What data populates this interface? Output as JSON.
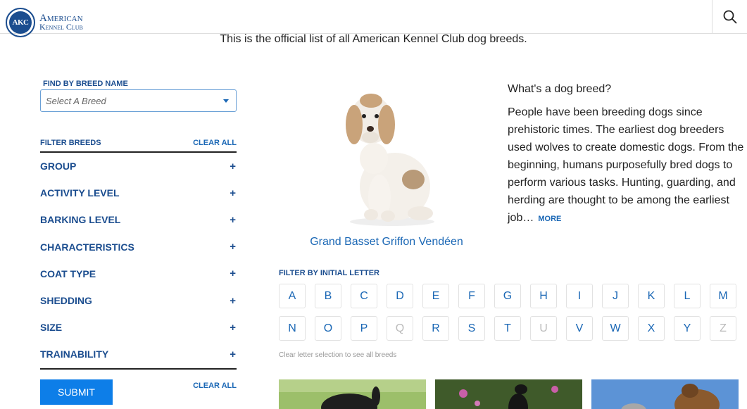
{
  "header": {
    "logo_line1": "American",
    "logo_line2": "Kennel Club",
    "logo_seal": "AKC",
    "search_icon": "magnifier"
  },
  "intro": "This is the official list of all American Kennel Club dog breeds.",
  "sidebar": {
    "find_label": "FIND BY BREED NAME",
    "select_placeholder": "Select A Breed",
    "filter_label": "FILTER BREEDS",
    "clear_all_top": "CLEAR ALL",
    "filters": [
      {
        "label": "GROUP"
      },
      {
        "label": "ACTIVITY LEVEL"
      },
      {
        "label": "BARKING LEVEL"
      },
      {
        "label": "CHARACTERISTICS"
      },
      {
        "label": "COAT TYPE"
      },
      {
        "label": "SHEDDING"
      },
      {
        "label": "SIZE"
      },
      {
        "label": "TRAINABILITY"
      }
    ],
    "plus_symbol": "+",
    "submit_label": "SUBMIT",
    "clear_all_bottom": "CLEAR ALL"
  },
  "featured": {
    "breed_name": "Grand Basset Griffon Vendéen"
  },
  "explainer": {
    "title": "What's a dog breed?",
    "body": "People have been breeding dogs since prehistoric times. The earliest dog breeders used wolves to create domestic dogs. From the beginning, humans purposefully bred dogs to perform various tasks. Hunting, guarding, and herding are thought to be among the earliest job…",
    "more": "MORE"
  },
  "letters": {
    "label": "FILTER BY INITIAL LETTER",
    "row1": [
      {
        "l": "A",
        "enabled": true
      },
      {
        "l": "B",
        "enabled": true
      },
      {
        "l": "C",
        "enabled": true
      },
      {
        "l": "D",
        "enabled": true
      },
      {
        "l": "E",
        "enabled": true
      },
      {
        "l": "F",
        "enabled": true
      },
      {
        "l": "G",
        "enabled": true
      },
      {
        "l": "H",
        "enabled": true
      },
      {
        "l": "I",
        "enabled": true
      },
      {
        "l": "J",
        "enabled": true
      },
      {
        "l": "K",
        "enabled": true
      },
      {
        "l": "L",
        "enabled": true
      },
      {
        "l": "M",
        "enabled": true
      }
    ],
    "row2": [
      {
        "l": "N",
        "enabled": true
      },
      {
        "l": "O",
        "enabled": true
      },
      {
        "l": "P",
        "enabled": true
      },
      {
        "l": "Q",
        "enabled": false
      },
      {
        "l": "R",
        "enabled": true
      },
      {
        "l": "S",
        "enabled": true
      },
      {
        "l": "T",
        "enabled": true
      },
      {
        "l": "U",
        "enabled": false
      },
      {
        "l": "V",
        "enabled": true
      },
      {
        "l": "W",
        "enabled": true
      },
      {
        "l": "X",
        "enabled": true
      },
      {
        "l": "Y",
        "enabled": true
      },
      {
        "l": "Z",
        "enabled": false
      }
    ],
    "note": "Clear letter selection to see all breeds"
  },
  "colors": {
    "brand_blue": "#1b4d8f",
    "link_blue": "#1a67b5",
    "button_blue": "#0d7ee8",
    "disabled_gray": "#bbbbbb"
  }
}
